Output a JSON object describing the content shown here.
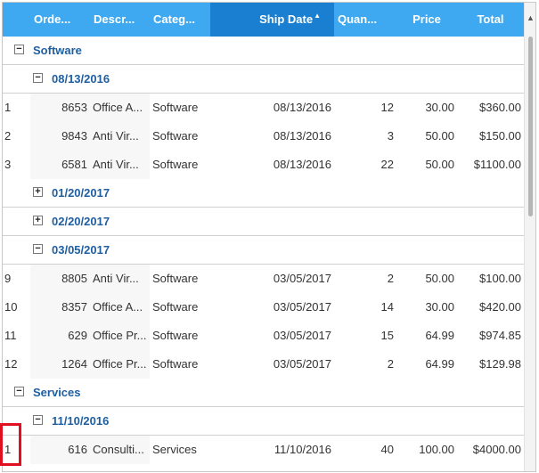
{
  "columns": [
    {
      "label": "Orde...",
      "sorted": false
    },
    {
      "label": "Descr...",
      "sorted": false
    },
    {
      "label": "Categ...",
      "sorted": false
    },
    {
      "label": "Ship Date",
      "sorted": true
    },
    {
      "label": "Quan...",
      "sorted": false
    },
    {
      "label": "Price",
      "sorted": false
    },
    {
      "label": "Total",
      "sorted": false
    }
  ],
  "sort_indicator": "▲",
  "groups": [
    {
      "name": "Software",
      "expanded": true,
      "subgroups": [
        {
          "name": "08/13/2016",
          "expanded": true,
          "rows": [
            {
              "index": "1",
              "order": "8653",
              "desc": "Office A...",
              "cat": "Software",
              "date": "08/13/2016",
              "qty": "12",
              "price": "30.00",
              "total": "$360.00"
            },
            {
              "index": "2",
              "order": "9843",
              "desc": "Anti Vir...",
              "cat": "Software",
              "date": "08/13/2016",
              "qty": "3",
              "price": "50.00",
              "total": "$150.00"
            },
            {
              "index": "3",
              "order": "6581",
              "desc": "Anti Vir...",
              "cat": "Software",
              "date": "08/13/2016",
              "qty": "22",
              "price": "50.00",
              "total": "$1100.00"
            }
          ]
        },
        {
          "name": "01/20/2017",
          "expanded": false,
          "rows": []
        },
        {
          "name": "02/20/2017",
          "expanded": false,
          "rows": []
        },
        {
          "name": "03/05/2017",
          "expanded": true,
          "rows": [
            {
              "index": "9",
              "order": "8805",
              "desc": "Anti Vir...",
              "cat": "Software",
              "date": "03/05/2017",
              "qty": "2",
              "price": "50.00",
              "total": "$100.00"
            },
            {
              "index": "10",
              "order": "8357",
              "desc": "Office A...",
              "cat": "Software",
              "date": "03/05/2017",
              "qty": "14",
              "price": "30.00",
              "total": "$420.00"
            },
            {
              "index": "11",
              "order": "629",
              "desc": "Office Pr...",
              "cat": "Software",
              "date": "03/05/2017",
              "qty": "15",
              "price": "64.99",
              "total": "$974.85"
            },
            {
              "index": "12",
              "order": "1264",
              "desc": "Office Pr...",
              "cat": "Software",
              "date": "03/05/2017",
              "qty": "2",
              "price": "64.99",
              "total": "$129.98"
            }
          ]
        }
      ]
    },
    {
      "name": "Services",
      "expanded": true,
      "subgroups": [
        {
          "name": "11/10/2016",
          "expanded": true,
          "rows": [
            {
              "index": "1",
              "order": "616",
              "desc": "Consulti...",
              "cat": "Services",
              "date": "11/10/2016",
              "qty": "40",
              "price": "100.00",
              "total": "$4000.00"
            }
          ]
        }
      ]
    }
  ],
  "colors": {
    "header_bg": "#3ea9f0",
    "header_sorted_bg": "#1a7fd0",
    "group_text": "#1f5fa0",
    "highlight": "#e01020"
  }
}
